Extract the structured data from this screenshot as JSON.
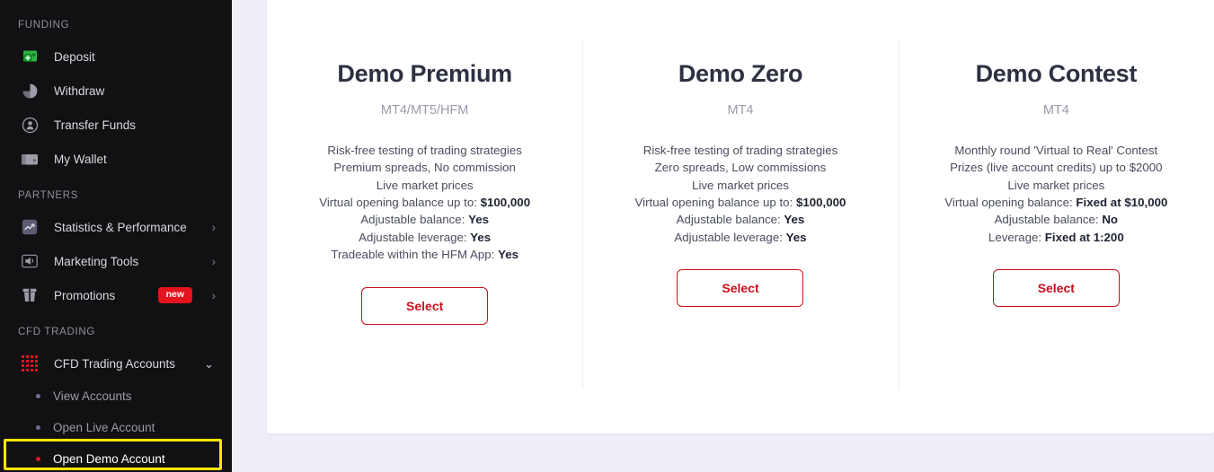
{
  "sidebar": {
    "sections": [
      {
        "label": "FUNDING",
        "items": [
          {
            "label": "Deposit",
            "icon": "deposit-icon"
          },
          {
            "label": "Withdraw",
            "icon": "withdraw-icon"
          },
          {
            "label": "Transfer Funds",
            "icon": "transfer-funds-icon"
          },
          {
            "label": "My Wallet",
            "icon": "wallet-icon"
          }
        ]
      },
      {
        "label": "PARTNERS",
        "items": [
          {
            "label": "Statistics & Performance",
            "icon": "statistics-icon",
            "chevron": "›"
          },
          {
            "label": "Marketing Tools",
            "icon": "megaphone-icon",
            "chevron": "›"
          },
          {
            "label": "Promotions",
            "icon": "gift-icon",
            "chevron": "›",
            "badge": "new"
          }
        ]
      },
      {
        "label": "CFD TRADING",
        "accounts": {
          "label": "CFD Trading Accounts",
          "icon": "grid-icon",
          "chevron": "⌄",
          "sub_items": [
            {
              "label": "View Accounts",
              "active": false
            },
            {
              "label": "Open Live Account",
              "active": false
            },
            {
              "label": "Open Demo Account",
              "active": true
            }
          ]
        }
      }
    ]
  },
  "cards": [
    {
      "title": "Demo Premium",
      "platform": "MT4/MT5/HFM",
      "features": [
        {
          "text": "Risk-free testing of trading strategies"
        },
        {
          "text": "Premium spreads, No commission"
        },
        {
          "text": "Live market prices"
        },
        {
          "text": "Virtual opening balance up to: ",
          "strong": "$100,000"
        },
        {
          "text": "Adjustable balance: ",
          "strong": "Yes"
        },
        {
          "text": "Adjustable leverage: ",
          "strong": "Yes"
        },
        {
          "text": "Tradeable within the HFM App: ",
          "strong": "Yes"
        }
      ],
      "button": "Select"
    },
    {
      "title": "Demo Zero",
      "platform": "MT4",
      "features": [
        {
          "text": "Risk-free testing of trading strategies"
        },
        {
          "text": "Zero spreads, Low commissions"
        },
        {
          "text": "Live market prices"
        },
        {
          "text": "Virtual opening balance up to: ",
          "strong": "$100,000"
        },
        {
          "text": "Adjustable balance: ",
          "strong": "Yes"
        },
        {
          "text": "Adjustable leverage: ",
          "strong": "Yes"
        }
      ],
      "button": "Select"
    },
    {
      "title": "Demo Contest",
      "platform": "MT4",
      "features": [
        {
          "text": "Monthly round 'Virtual to Real' Contest"
        },
        {
          "text": "Prizes (live account credits) up to $2000"
        },
        {
          "text": "Live market prices"
        },
        {
          "text": "Virtual opening balance: ",
          "strong": "Fixed at $10,000"
        },
        {
          "text": "Adjustable balance: ",
          "strong": "No"
        },
        {
          "text": "Leverage: ",
          "strong": "Fixed at 1:200"
        }
      ],
      "button": "Select"
    }
  ],
  "colors": {
    "sidebar_bg": "#111113",
    "page_bg": "#eeeef7",
    "accent_red": "#c9101e",
    "badge_red": "#e4131e",
    "deposit_green": "#2db742",
    "highlight_yellow": "#ffe600"
  }
}
